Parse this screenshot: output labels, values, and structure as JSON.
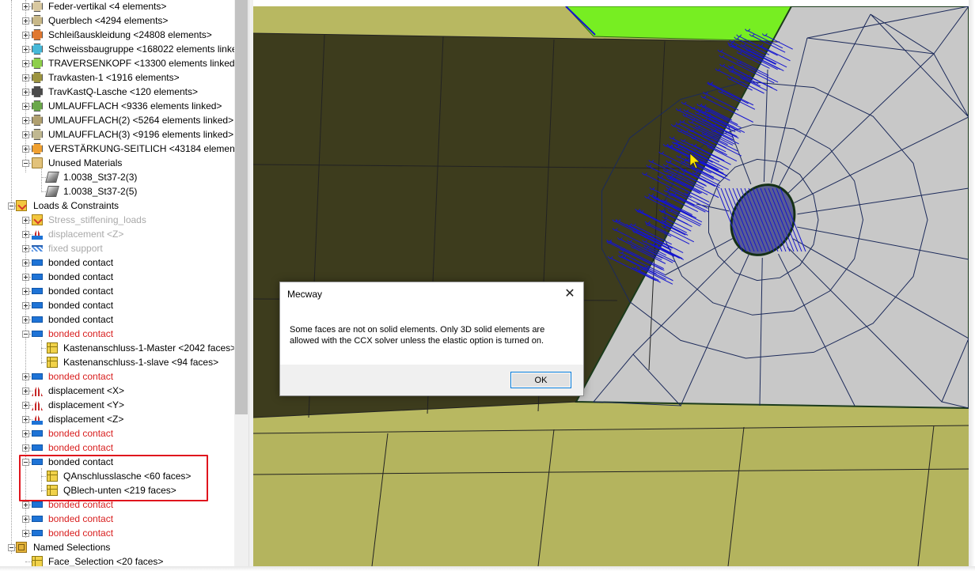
{
  "tree": {
    "rows": [
      {
        "label": "Feder-vertikal <4 elements>",
        "depth": 1,
        "icon": "part-icon",
        "color": "#d8c8a0",
        "expander": "plus",
        "style": "normal"
      },
      {
        "label": "Querblech <4294 elements>",
        "depth": 1,
        "icon": "part-icon",
        "color": "#c8b888",
        "expander": "plus",
        "style": "normal"
      },
      {
        "label": "Schleißauskleidung <24808 elements>",
        "depth": 1,
        "icon": "part-icon",
        "color": "#e07830",
        "expander": "plus",
        "style": "normal"
      },
      {
        "label": "Schweissbaugruppe <168022 elements linked>",
        "depth": 1,
        "icon": "part-icon",
        "color": "#46b8d8",
        "expander": "plus",
        "style": "normal"
      },
      {
        "label": "TRAVERSENKOPF <13300 elements linked>",
        "depth": 1,
        "icon": "part-icon",
        "color": "#8ecf4a",
        "expander": "plus",
        "style": "normal"
      },
      {
        "label": "Travkasten-1 <1916 elements>",
        "depth": 1,
        "icon": "part-icon",
        "color": "#9c9440",
        "expander": "plus",
        "style": "normal"
      },
      {
        "label": "TravKastQ-Lasche <120 elements>",
        "depth": 1,
        "icon": "part-icon",
        "color": "#4a4a4a",
        "expander": "plus",
        "style": "normal"
      },
      {
        "label": "UMLAUFFLACH <9336 elements linked>",
        "depth": 1,
        "icon": "part-icon",
        "color": "#6aa84a",
        "expander": "plus",
        "style": "normal"
      },
      {
        "label": "UMLAUFFLACH(2) <5264 elements linked>",
        "depth": 1,
        "icon": "part-icon",
        "color": "#b0a070",
        "expander": "plus",
        "style": "normal"
      },
      {
        "label": "UMLAUFFLACH(3) <9196 elements linked>",
        "depth": 1,
        "icon": "part-icon",
        "color": "#c0b890",
        "expander": "plus",
        "style": "normal"
      },
      {
        "label": "VERSTÄRKUNG-SEITLICH <43184 elements linked>",
        "depth": 1,
        "icon": "part-icon",
        "color": "#f0a030",
        "expander": "plus",
        "style": "normal"
      },
      {
        "label": "Unused Materials",
        "depth": 1,
        "icon": "folder-icon",
        "color": "#e2c27a",
        "expander": "minus",
        "style": "normal"
      },
      {
        "label": "1.0038_St37-2(3)",
        "depth": 2,
        "icon": "material-icon",
        "color": "#9b9b9b",
        "expander": "none",
        "style": "normal"
      },
      {
        "label": "1.0038_St37-2(5)",
        "depth": 2,
        "icon": "material-icon",
        "color": "#9b9b9b",
        "expander": "none",
        "style": "normal"
      },
      {
        "label": "Loads & Constraints",
        "depth": 0,
        "icon": "loads-folder-icon",
        "color": "#f3c73f",
        "expander": "minus",
        "style": "normal"
      },
      {
        "label": "Stress_stiffening_loads",
        "depth": 1,
        "icon": "loads-folder-icon",
        "color": "#f3c73f",
        "expander": "plus",
        "style": "disabled"
      },
      {
        "label": "displacement <Z>",
        "depth": 1,
        "icon": "displacement-z-icon",
        "color": "#c62828",
        "expander": "plus",
        "style": "disabled"
      },
      {
        "label": "fixed support",
        "depth": 1,
        "icon": "fixed-support-icon",
        "color": "#4a8ae0",
        "expander": "plus",
        "style": "disabled"
      },
      {
        "label": "bonded contact",
        "depth": 1,
        "icon": "bonded-contact-icon",
        "color": "#1e73d6",
        "expander": "plus",
        "style": "normal"
      },
      {
        "label": "bonded contact",
        "depth": 1,
        "icon": "bonded-contact-icon",
        "color": "#1e73d6",
        "expander": "plus",
        "style": "normal"
      },
      {
        "label": "bonded contact",
        "depth": 1,
        "icon": "bonded-contact-icon",
        "color": "#1e73d6",
        "expander": "plus",
        "style": "normal"
      },
      {
        "label": "bonded contact",
        "depth": 1,
        "icon": "bonded-contact-icon",
        "color": "#1e73d6",
        "expander": "plus",
        "style": "normal"
      },
      {
        "label": "bonded contact",
        "depth": 1,
        "icon": "bonded-contact-icon",
        "color": "#1e73d6",
        "expander": "plus",
        "style": "normal"
      },
      {
        "label": "bonded contact",
        "depth": 1,
        "icon": "bonded-contact-icon",
        "color": "#1e73d6",
        "expander": "minus",
        "style": "error"
      },
      {
        "label": "Kastenanschluss-1-Master <2042 faces>",
        "depth": 2,
        "icon": "face-selection-icon",
        "color": "#f1d24a",
        "expander": "none",
        "style": "normal"
      },
      {
        "label": "Kastenanschluss-1-slave <94 faces>",
        "depth": 2,
        "icon": "face-selection-icon",
        "color": "#f1d24a",
        "expander": "none",
        "style": "normal"
      },
      {
        "label": "bonded contact",
        "depth": 1,
        "icon": "bonded-contact-icon",
        "color": "#1e73d6",
        "expander": "plus",
        "style": "error"
      },
      {
        "label": "displacement <X>",
        "depth": 1,
        "icon": "displacement-icon",
        "color": "#c62828",
        "expander": "plus",
        "style": "normal"
      },
      {
        "label": "displacement <Y>",
        "depth": 1,
        "icon": "displacement-icon",
        "color": "#c62828",
        "expander": "plus",
        "style": "normal"
      },
      {
        "label": "displacement <Z>",
        "depth": 1,
        "icon": "displacement-z-icon",
        "color": "#c62828",
        "expander": "plus",
        "style": "normal"
      },
      {
        "label": "bonded contact",
        "depth": 1,
        "icon": "bonded-contact-icon",
        "color": "#1e73d6",
        "expander": "plus",
        "style": "error"
      },
      {
        "label": "bonded contact",
        "depth": 1,
        "icon": "bonded-contact-icon",
        "color": "#1e73d6",
        "expander": "plus",
        "style": "error"
      },
      {
        "label": "bonded contact",
        "depth": 1,
        "icon": "bonded-contact-icon",
        "color": "#1e73d6",
        "expander": "minus",
        "style": "normal"
      },
      {
        "label": "QAnschlusslasche <60 faces>",
        "depth": 2,
        "icon": "face-selection-icon",
        "color": "#f1d24a",
        "expander": "none",
        "style": "normal"
      },
      {
        "label": "QBlech-unten <219 faces>",
        "depth": 2,
        "icon": "face-selection-icon",
        "color": "#f1d24a",
        "expander": "none",
        "style": "normal"
      },
      {
        "label": "bonded contact",
        "depth": 1,
        "icon": "bonded-contact-icon",
        "color": "#1e73d6",
        "expander": "plus",
        "style": "error"
      },
      {
        "label": "bonded contact",
        "depth": 1,
        "icon": "bonded-contact-icon",
        "color": "#1e73d6",
        "expander": "plus",
        "style": "error"
      },
      {
        "label": "bonded contact",
        "depth": 1,
        "icon": "bonded-contact-icon",
        "color": "#1e73d6",
        "expander": "plus",
        "style": "error"
      },
      {
        "label": "Named Selections",
        "depth": 0,
        "icon": "named-selections-icon",
        "color": "#e4b33a",
        "expander": "minus",
        "style": "normal"
      },
      {
        "label": "Face_Selection <20 faces>",
        "depth": 1,
        "icon": "face-selection-icon",
        "color": "#f1d24a",
        "expander": "none",
        "style": "normal"
      }
    ]
  },
  "dialog": {
    "title": "Mecway",
    "close_symbol": "✕",
    "message": "Some faces are not on solid elements. Only 3D solid elements are allowed with the CCX solver unless the elastic option is turned on.",
    "ok_label": "OK"
  },
  "colors": {
    "error_text": "#d81e1e",
    "disabled_text": "#a9a9a9",
    "highlight_box": "#e0151d",
    "mesh_face": "#b8b861",
    "mesh_face_dark": "#3b3a1a",
    "plate_gray": "#c8c8c8",
    "arrow_blue": "#1414d0",
    "green_part": "#77ee22"
  }
}
